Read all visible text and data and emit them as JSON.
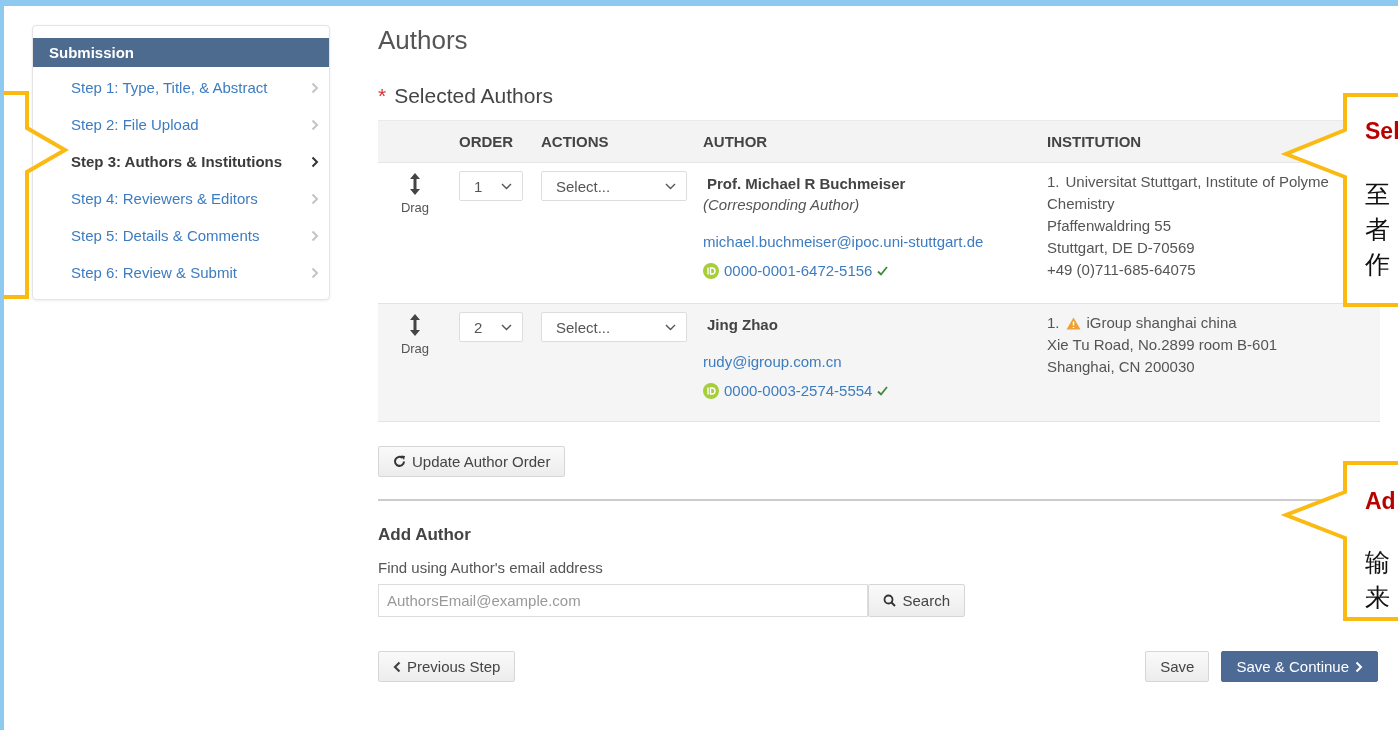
{
  "sidebar": {
    "title": "Submission",
    "steps": [
      {
        "label": "Step 1: Type, Title, & Abstract",
        "selected": false
      },
      {
        "label": "Step 2: File Upload",
        "selected": false
      },
      {
        "label": "Step 3: Authors & Institutions",
        "selected": true
      },
      {
        "label": "Step 4: Reviewers & Editors",
        "selected": false
      },
      {
        "label": "Step 5: Details & Comments",
        "selected": false
      },
      {
        "label": "Step 6: Review & Submit",
        "selected": false
      }
    ]
  },
  "page_title": "Authors",
  "section": {
    "required_mark": "*",
    "title": "Selected Authors"
  },
  "table": {
    "columns": [
      "ORDER",
      "ACTIONS",
      "AUTHOR",
      "INSTITUTION"
    ],
    "rows": [
      {
        "drag_label": "Drag",
        "order": "1",
        "action": "Select...",
        "name": "Prof. Michael R Buchmeiser",
        "role": "(Corresponding Author)",
        "email": "michael.buchmeiser@ipoc.uni-stuttgart.de",
        "orcid": "0000-0001-6472-5156",
        "verified": true,
        "institution": {
          "prefix": "1.",
          "warning": false,
          "name": "Universitat Stuttgart, Institute of Polyme",
          "lines": [
            "Chemistry",
            "Pfaffenwaldring 55",
            "Stuttgart, DE D-70569",
            "+49 (0)711-685-64075"
          ]
        }
      },
      {
        "drag_label": "Drag",
        "order": "2",
        "action": "Select...",
        "name": "Jing Zhao",
        "email": "rudy@igroup.com.cn",
        "orcid": "0000-0003-2574-5554",
        "verified": true,
        "institution": {
          "prefix": "1.",
          "warning": true,
          "name": "iGroup shanghai china",
          "lines": [
            "Xie Tu Road, No.2899 room B-601",
            "Shanghai, CN 200030"
          ]
        }
      }
    ]
  },
  "update_button": "Update Author Order",
  "add_author": {
    "title": "Add Author",
    "hint": "Find using Author's email address",
    "placeholder": "AuthorsEmail@example.com",
    "search_button": "Search"
  },
  "footer": {
    "previous": "Previous Step",
    "save": "Save",
    "continue": "Save & Continue"
  },
  "callouts": [
    {
      "title": "Sel",
      "lines": [
        "至",
        "者",
        "作"
      ]
    },
    {
      "title": "Ad",
      "lines": [
        "输",
        "来"
      ]
    }
  ]
}
